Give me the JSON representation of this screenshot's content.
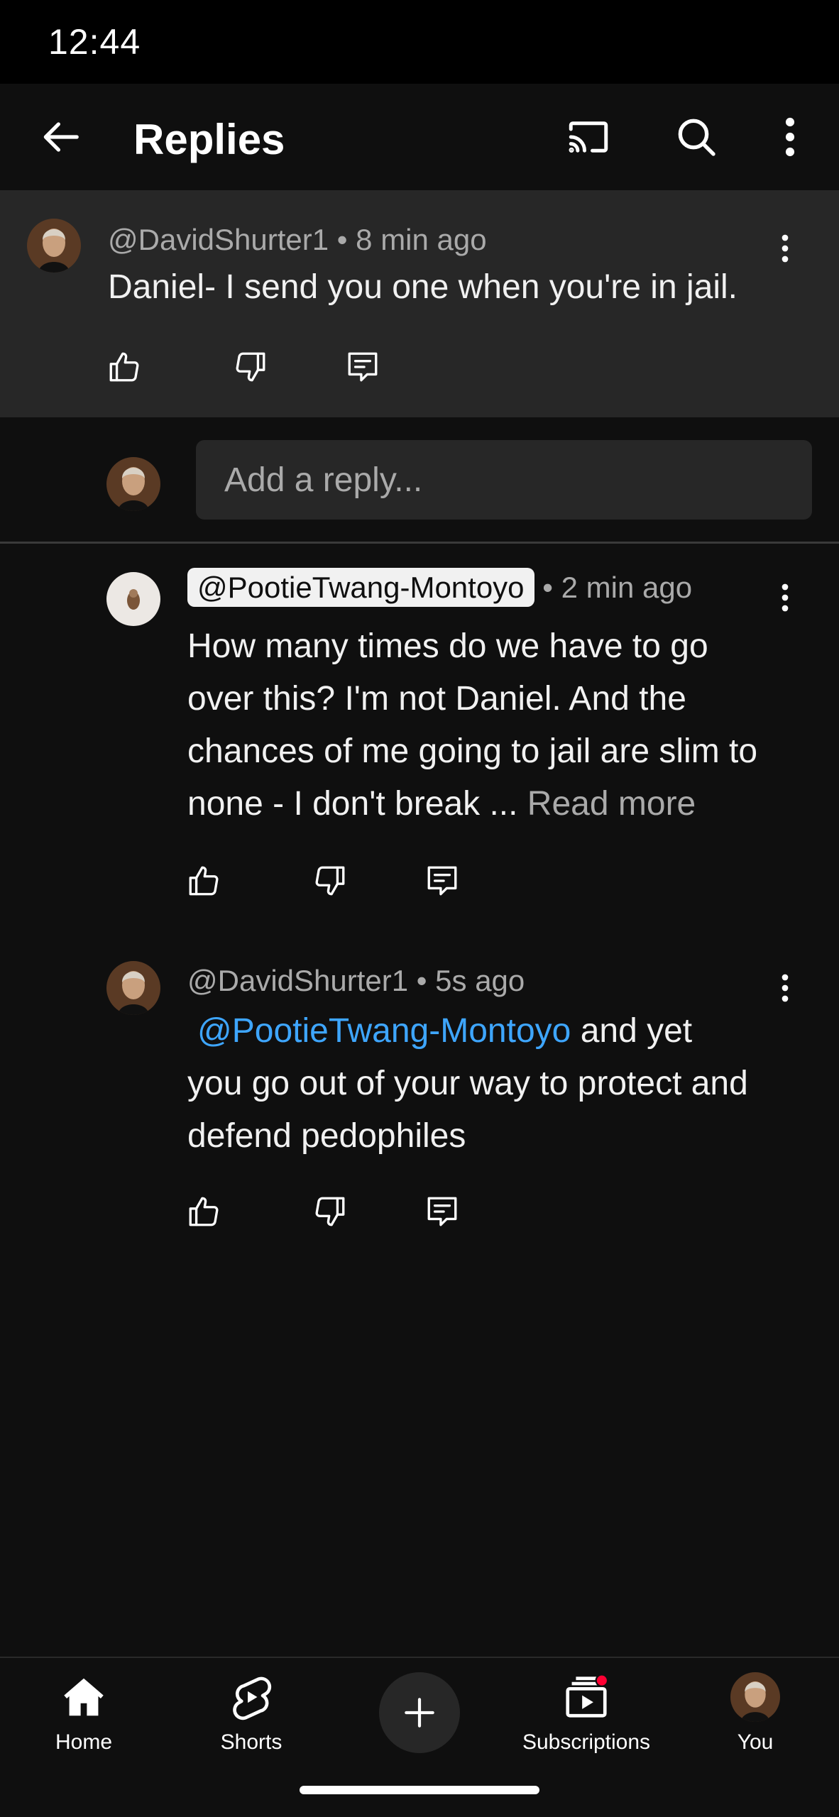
{
  "status_bar": {
    "time": "12:44"
  },
  "app_bar": {
    "title": "Replies"
  },
  "parent_comment": {
    "author": "@DavidShurter1",
    "separator": "•",
    "time": "8 min ago",
    "text": "Daniel- I send you one when you're in jail."
  },
  "reply_box": {
    "placeholder": "Add a reply..."
  },
  "replies": [
    {
      "author": "@PootieTwang-Montoyo",
      "separator": "•",
      "time": "2 min ago",
      "text": "How many times do we have to go over this? I'm not Daniel. And the chances of me going to jail are slim to none - I don't break ...",
      "read_more": "Read more"
    },
    {
      "author": "@DavidShurter1",
      "separator": "•",
      "time": "5s ago",
      "mention": "@PootieTwang-Montoyo",
      "text": "and yet you go out of your way to protect and defend pedophiles"
    }
  ],
  "bottom_nav": {
    "home": "Home",
    "shorts": "Shorts",
    "subscriptions": "Subscriptions",
    "you": "You"
  },
  "colors": {
    "background": "#0f0f0f",
    "surface": "#272727",
    "mention": "#3ea6ff",
    "notification_dot": "#ff0033"
  }
}
